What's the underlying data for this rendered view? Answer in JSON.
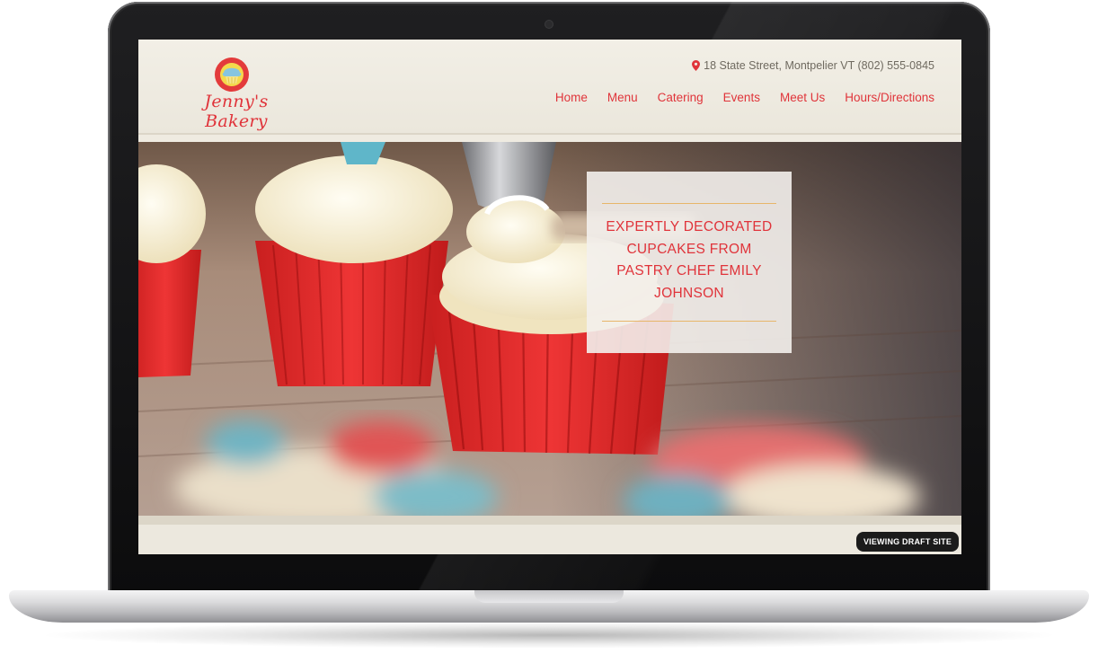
{
  "site": {
    "logo_text": "Jenny's Bakery",
    "address": "18 State Street, Montpelier VT (802) 555-0845",
    "nav": [
      {
        "label": "Home"
      },
      {
        "label": "Menu"
      },
      {
        "label": "Catering"
      },
      {
        "label": "Events"
      },
      {
        "label": "Meet Us"
      },
      {
        "label": "Hours/Directions"
      }
    ],
    "hero": {
      "tagline": "EXPERTLY DECORATED CUPCAKES FROM PASTRY CHEF EMILY JOHNSON"
    },
    "draft_badge": "VIEWING DRAFT SITE"
  },
  "colors": {
    "brand_red": "#e0333a",
    "header_bg": "#efebe1",
    "accent_gold": "#e7b66a"
  },
  "icons": {
    "logo": "cupcake-icon",
    "address": "map-pin-icon"
  }
}
